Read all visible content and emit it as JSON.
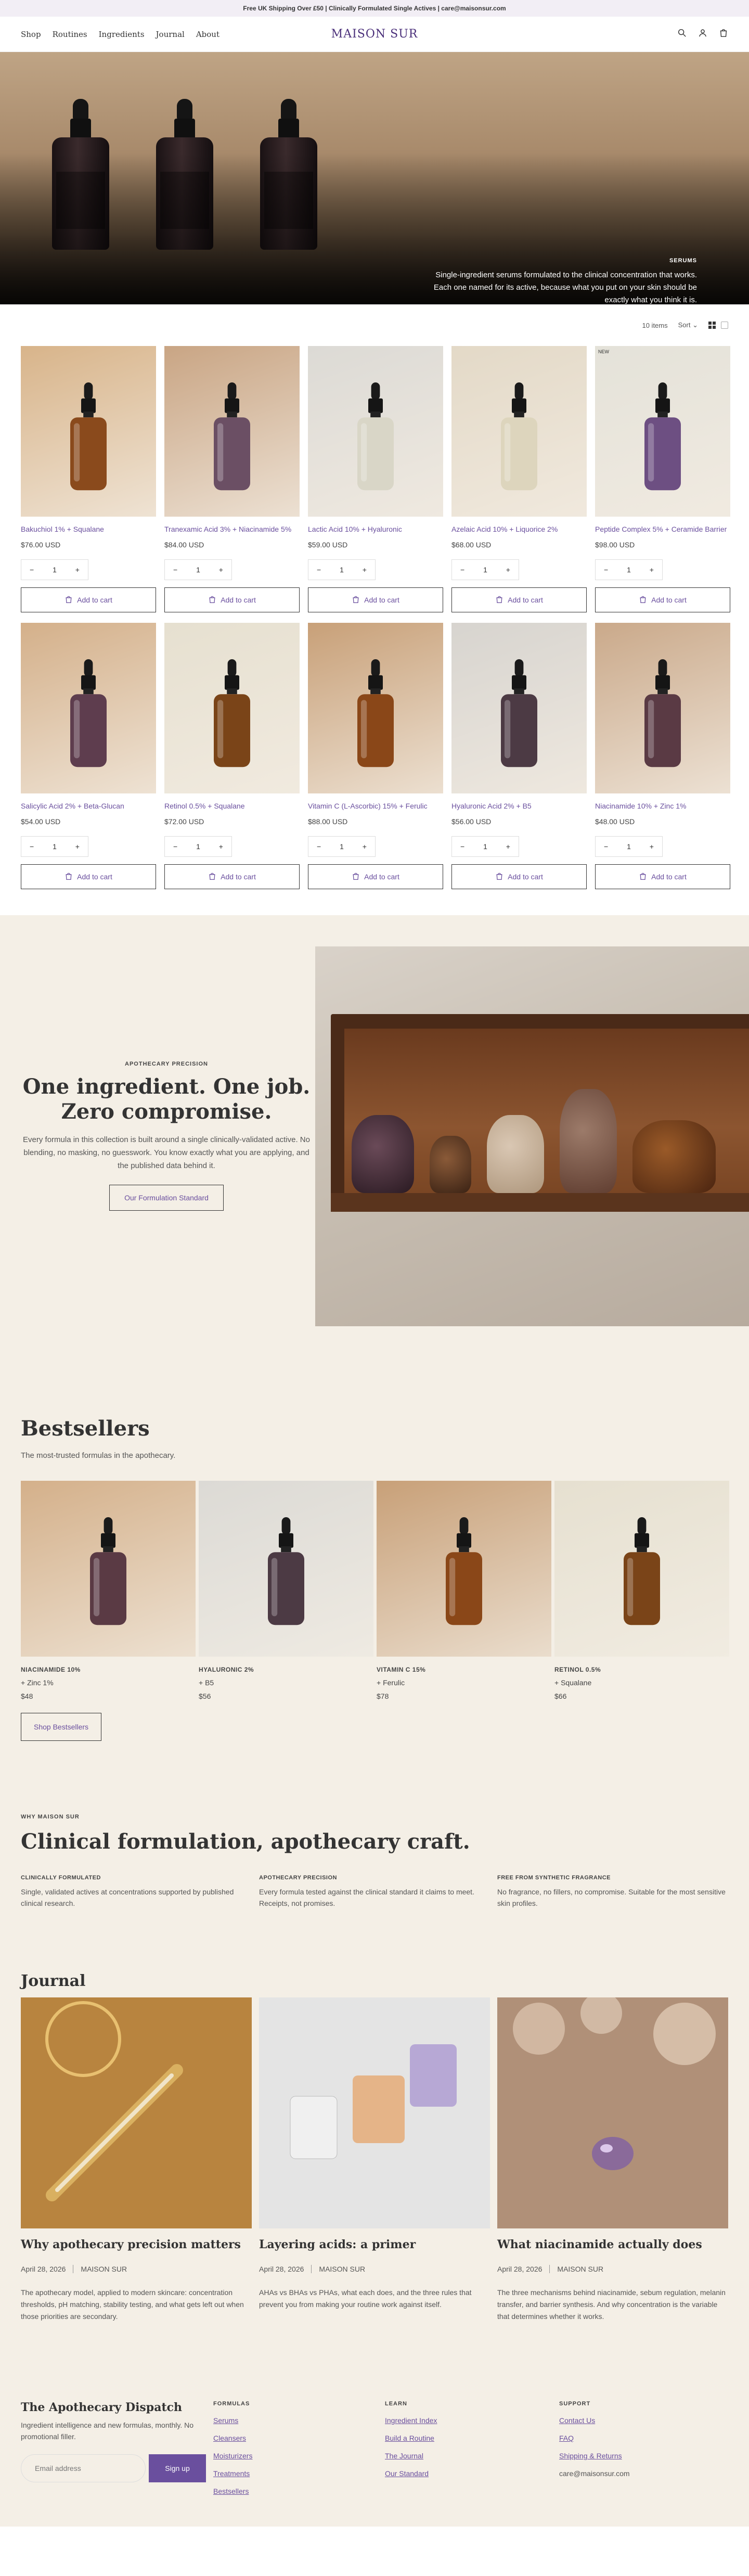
{
  "announcement": "Free UK Shipping Over £50 | Clinically Formulated Single Actives | care@maisonsur.com",
  "header": {
    "nav": [
      "Shop",
      "Routines",
      "Ingredients",
      "Journal",
      "About"
    ],
    "logo": "MAISON SUR",
    "icons": [
      "search-icon",
      "account-icon",
      "cart-icon"
    ]
  },
  "hero": {
    "eyebrow": "SERUMS",
    "description": "Single-ingredient serums formulated to the clinical concentration that works. Each one named for its active, because what you put on your skin should be exactly what you think it is."
  },
  "toolbar": {
    "count": "10 items",
    "sort": "Sort"
  },
  "products": [
    {
      "name": "Bakuchiol 1% + Squalane",
      "price": "$76.00 USD",
      "qty": "1",
      "cta": "Add to cart",
      "liquid": "#8a4a1c",
      "bg": "#d8b48a"
    },
    {
      "name": "Tranexamic Acid 3% + Niacinamide 5%",
      "price": "$84.00 USD",
      "qty": "1",
      "cta": "Add to cart",
      "liquid": "#6b4f64",
      "bg": "#c9a584"
    },
    {
      "name": "Lactic Acid 10% + Hyaluronic",
      "price": "$59.00 USD",
      "qty": "1",
      "cta": "Add to cart",
      "liquid": "#d9d6c7",
      "bg": "#dcdad5"
    },
    {
      "name": "Azelaic Acid 10% + Liquorice 2%",
      "price": "$68.00 USD",
      "qty": "1",
      "cta": "Add to cart",
      "liquid": "#ddd5bd",
      "bg": "#e3d9c7"
    },
    {
      "name": "Peptide Complex 5% + Ceramide Barrier",
      "price": "$98.00 USD",
      "qty": "1",
      "cta": "Add to cart",
      "liquid": "#6d4f82",
      "bg": "#e4e2d9",
      "badge": "NEW"
    },
    {
      "name": "Salicylic Acid 2% + Beta-Glucan",
      "price": "$54.00 USD",
      "qty": "1",
      "cta": "Add to cart",
      "liquid": "#5e3d4e",
      "bg": "#d4b08a"
    },
    {
      "name": "Retinol 0.5% + Squalane",
      "price": "$72.00 USD",
      "qty": "1",
      "cta": "Add to cart",
      "liquid": "#7a4418",
      "bg": "#e6e0d0"
    },
    {
      "name": "Vitamin C (L-Ascorbic) 15% + Ferulic",
      "price": "$88.00 USD",
      "qty": "1",
      "cta": "Add to cart",
      "liquid": "#8a4718",
      "bg": "#c8a078"
    },
    {
      "name": "Hyaluronic Acid 2% + B5",
      "price": "$56.00 USD",
      "qty": "1",
      "cta": "Add to cart",
      "liquid": "#4c3a44",
      "bg": "#d7d4cf"
    },
    {
      "name": "Niacinamide 10% + Zinc 1%",
      "price": "$48.00 USD",
      "qty": "1",
      "cta": "Add to cart",
      "liquid": "#5a3a44",
      "bg": "#caa98a"
    }
  ],
  "apothecary": {
    "eyebrow": "APOTHECARY PRECISION",
    "title": "One ingredient. One job. Zero compromise.",
    "body": "Every formula in this collection is built around a single clinically-validated active. No blending, no masking, no guesswork. You know exactly what you are applying, and the published data behind it.",
    "cta": "Our Formulation Standard"
  },
  "bestsellers": {
    "title": "Bestsellers",
    "subtitle": "The most-trusted formulas in the apothecary.",
    "items": [
      {
        "name": "NIACINAMIDE 10%",
        "name2": "+ Zinc 1%",
        "price": "$48",
        "liquid": "#5a3a44",
        "bg": "#d4b08a"
      },
      {
        "name": "HYALURONIC 2%",
        "name2": "+ B5",
        "price": "$56",
        "liquid": "#4c3a44",
        "bg": "#dcdad5"
      },
      {
        "name": "VITAMIN C 15%",
        "name2": "+ Ferulic",
        "price": "$78",
        "liquid": "#8a4718",
        "bg": "#c8a078"
      },
      {
        "name": "RETINOL 0.5%",
        "name2": "+ Squalane",
        "price": "$66",
        "liquid": "#7a4418",
        "bg": "#e6e0d0"
      }
    ],
    "cta": "Shop Bestsellers"
  },
  "why": {
    "eyebrow": "WHY MAISON SUR",
    "title": "Clinical formulation, apothecary craft.",
    "columns": [
      {
        "title": "CLINICALLY FORMULATED",
        "desc": "Single, validated actives at concentrations supported by published clinical research."
      },
      {
        "title": "APOTHECARY PRECISION",
        "desc": "Every formula tested against the clinical standard it claims to meet. Receipts, not promises."
      },
      {
        "title": "FREE FROM SYNTHETIC FRAGRANCE",
        "desc": "No fragrance, no fillers, no compromise. Suitable for the most sensitive skin profiles."
      }
    ]
  },
  "journal": {
    "title": "Journal",
    "articles": [
      {
        "title": "Why apothecary precision matters",
        "date": "April 28, 2026",
        "author": "MAISON SUR",
        "desc": "The apothecary model, applied to modern skincare: concentration thresholds, pH matching, stability testing, and what gets left out when those priorities are secondary.",
        "bg": "#c89a55"
      },
      {
        "title": "Layering acids: a primer",
        "date": "April 28, 2026",
        "author": "MAISON SUR",
        "desc": "AHAs vs BHAs vs PHAs, what each does, and the three rules that prevent you from making your routine work against itself.",
        "bg": "#dcdcdc"
      },
      {
        "title": "What niacinamide actually does",
        "date": "April 28, 2026",
        "author": "MAISON SUR",
        "desc": "The three mechanisms behind niacinamide, sebum regulation, melanin transfer, and barrier synthesis. And why concentration is the variable that determines whether it works.",
        "bg": "#b89a82"
      }
    ]
  },
  "footer": {
    "title": "The Apothecary Dispatch",
    "subtitle": "Ingredient intelligence and new formulas, monthly. No promotional filler.",
    "email_placeholder": "Email address",
    "signup": "Sign up",
    "columns": [
      {
        "heading": "FORMULAS",
        "links": [
          "Serums",
          "Cleansers",
          "Moisturizers",
          "Treatments",
          "Bestsellers"
        ]
      },
      {
        "heading": "LEARN",
        "links": [
          "Ingredient Index",
          "Build a Routine",
          "The Journal",
          "Our Standard"
        ]
      },
      {
        "heading": "SUPPORT",
        "links": [
          "Contact Us",
          "FAQ",
          "Shipping & Returns"
        ],
        "email": "care@maisonsur.com"
      }
    ]
  },
  "colors": {
    "accent": "#6a4f9e",
    "cream": "#f4efe6"
  }
}
